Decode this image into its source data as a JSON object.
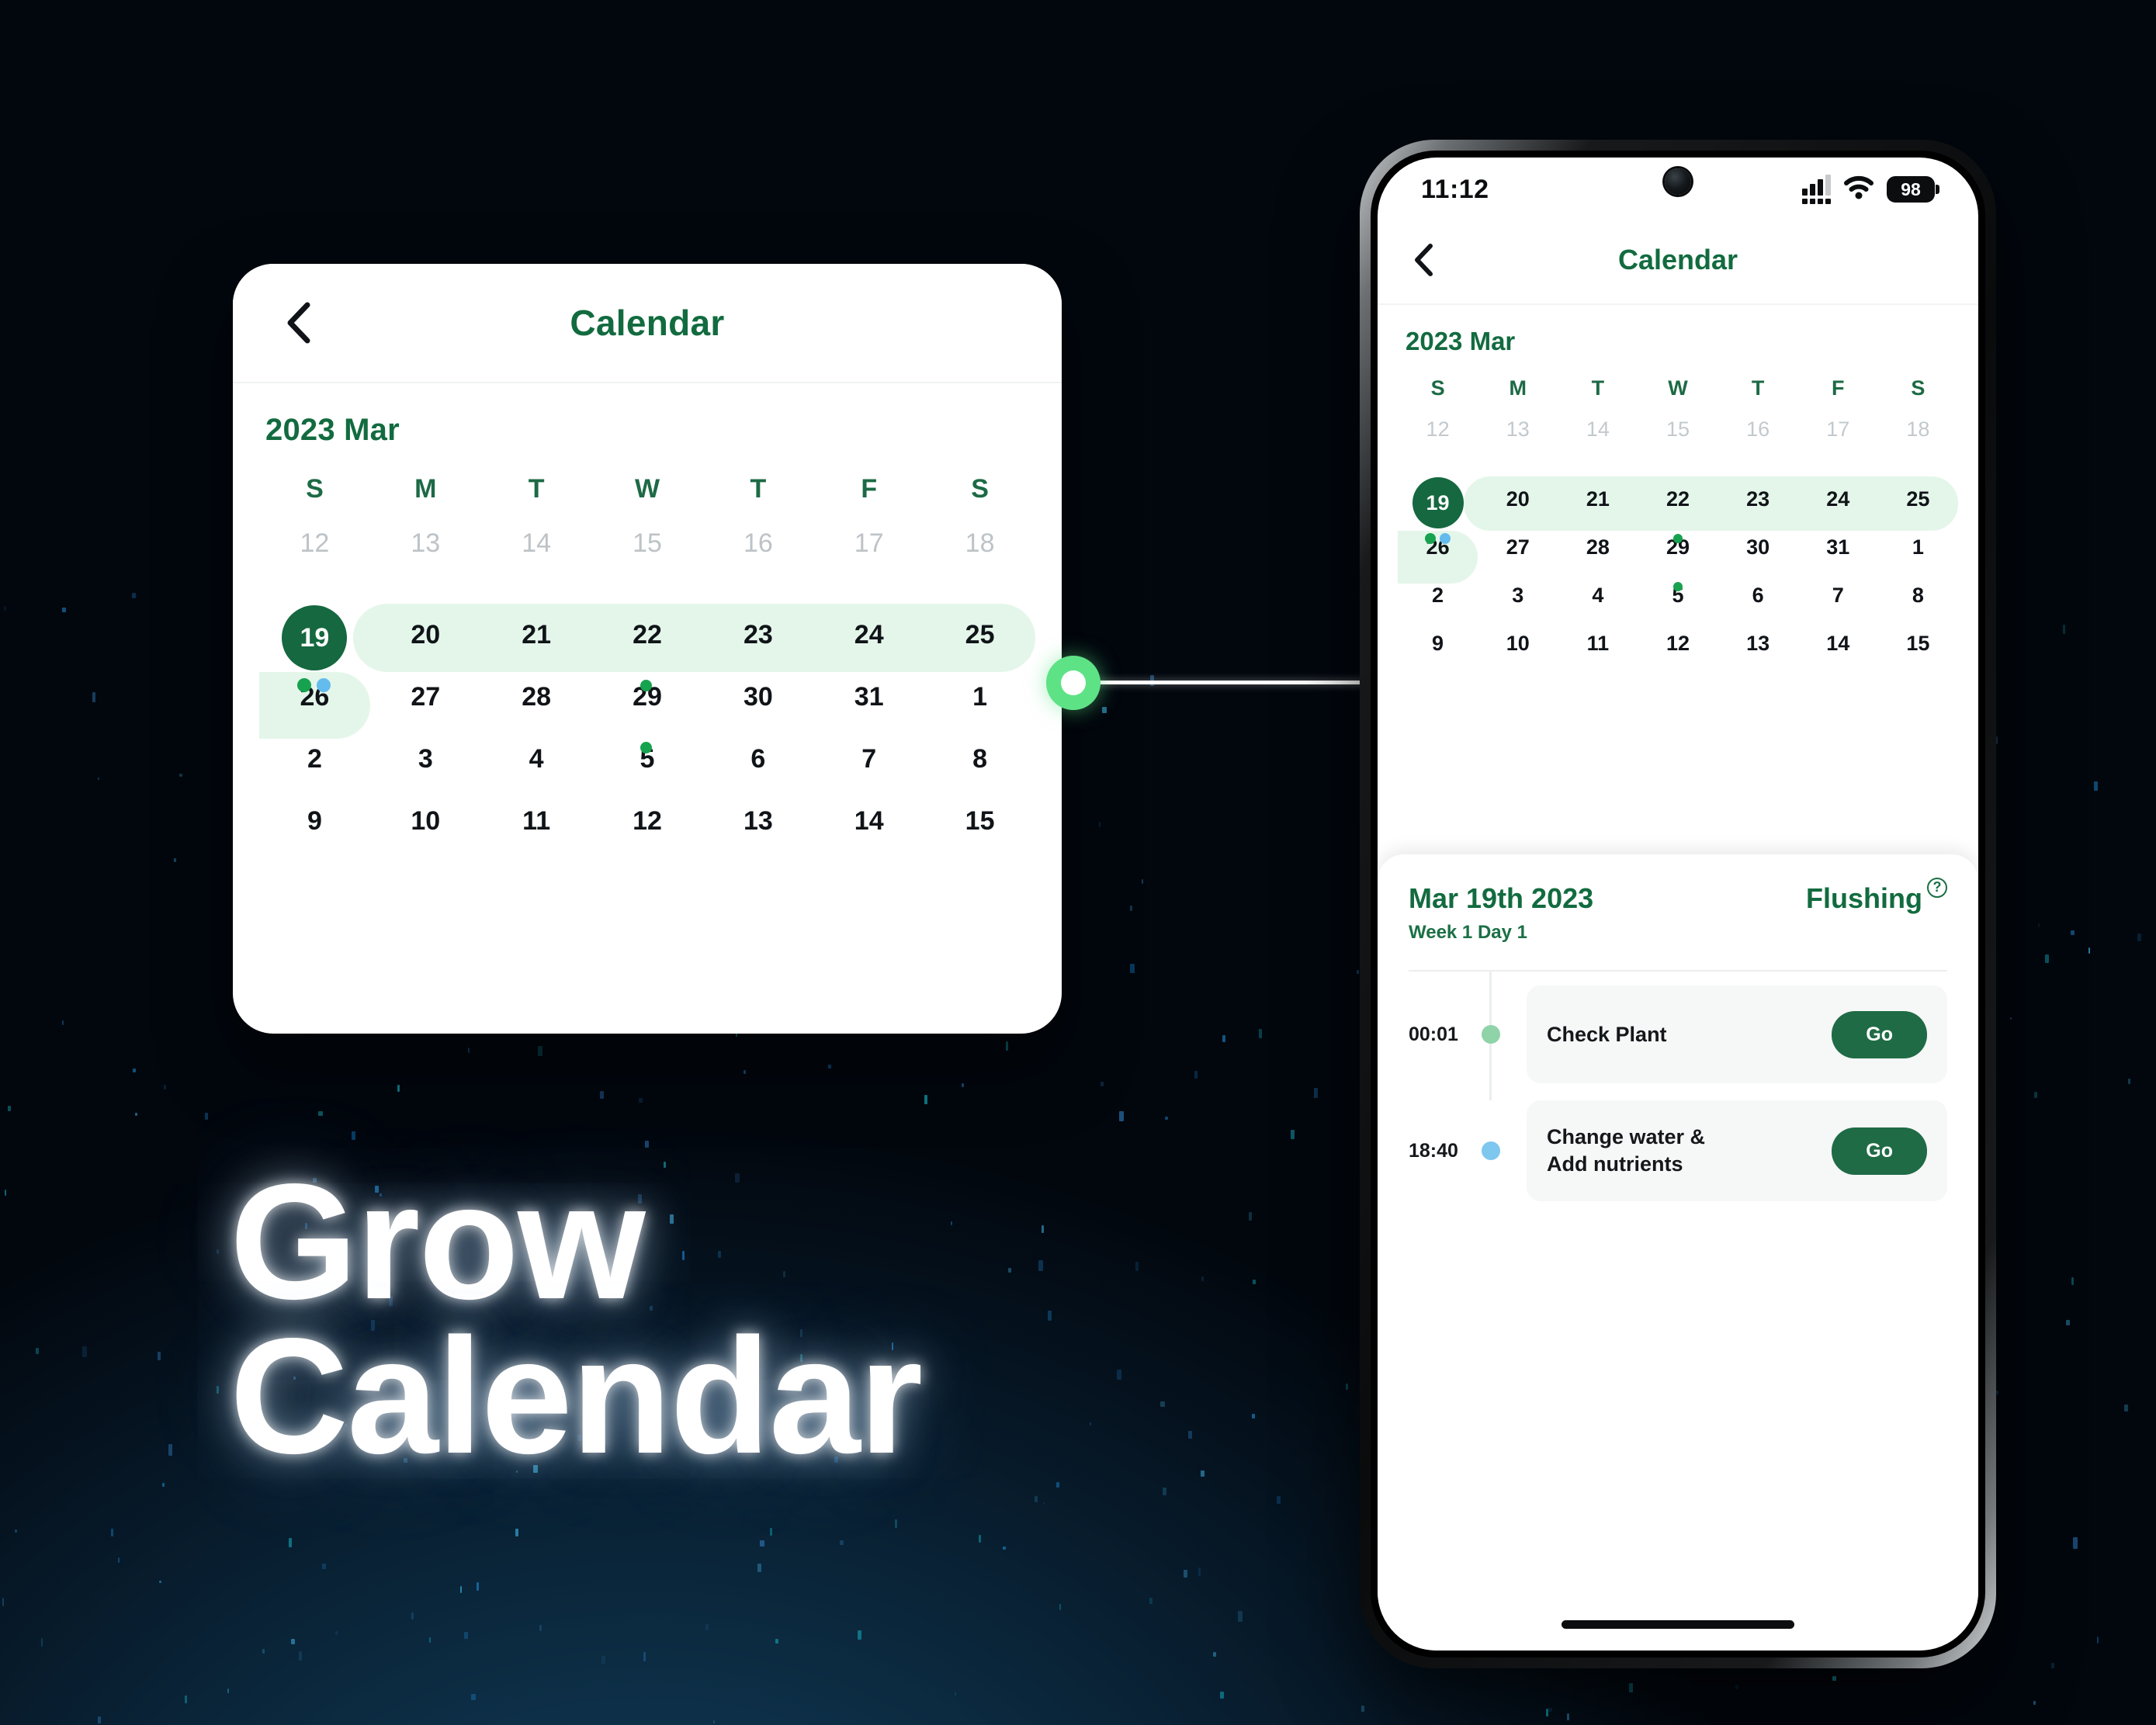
{
  "theme": {
    "brand_green": "#126b3f",
    "accent_green": "#1f6b45",
    "light_green_band": "#e4f6ea",
    "dot_green": "#17a24f",
    "dot_blue": "#63bced",
    "connector_green": "#5ee286",
    "background_navy": "#0d2f47"
  },
  "headline": {
    "line1": "Grow",
    "line2": "Calendar"
  },
  "card": {
    "back_icon": "chevron-left-icon",
    "title": "Calendar",
    "month": "2023 Mar",
    "dow": [
      "S",
      "M",
      "T",
      "W",
      "T",
      "F",
      "S"
    ],
    "weeks": [
      [
        "12",
        "13",
        "14",
        "15",
        "16",
        "17",
        "18"
      ],
      [
        "19",
        "20",
        "21",
        "22",
        "23",
        "24",
        "25"
      ],
      [
        "26",
        "27",
        "28",
        "29",
        "30",
        "31",
        "1"
      ],
      [
        "2",
        "3",
        "4",
        "5",
        "6",
        "7",
        "8"
      ],
      [
        "9",
        "10",
        "11",
        "12",
        "13",
        "14",
        "15"
      ]
    ],
    "selected_day": "19",
    "selected_day_dots": [
      "green",
      "blue"
    ],
    "event_dots": {
      "22": "green",
      "29": "green"
    },
    "muted_week_index": 0,
    "highlight_week_index": 1,
    "highlight_next_cell": "26"
  },
  "phone": {
    "status": {
      "time": "11:12",
      "signal_icon": "cellular-signal-icon",
      "wifi_icon": "wifi-icon",
      "battery_icon": "battery-icon",
      "battery_level": "98"
    },
    "nav": {
      "back_icon": "chevron-left-icon",
      "title": "Calendar"
    },
    "month": "2023 Mar",
    "dow": [
      "S",
      "M",
      "T",
      "W",
      "T",
      "F",
      "S"
    ],
    "weeks": [
      [
        "12",
        "13",
        "14",
        "15",
        "16",
        "17",
        "18"
      ],
      [
        "19",
        "20",
        "21",
        "22",
        "23",
        "24",
        "25"
      ],
      [
        "26",
        "27",
        "28",
        "29",
        "30",
        "31",
        "1"
      ],
      [
        "2",
        "3",
        "4",
        "5",
        "6",
        "7",
        "8"
      ],
      [
        "9",
        "10",
        "11",
        "12",
        "13",
        "14",
        "15"
      ]
    ],
    "selected_day": "19",
    "event_panel": {
      "date": "Mar 19th 2023",
      "subtitle": "Week 1 Day 1",
      "stage": "Flushing",
      "help_icon": "help-circle-icon",
      "help_glyph": "?",
      "events": [
        {
          "time": "00:01",
          "bullet": "green",
          "label": "Check Plant",
          "label_line2": "",
          "action": "Go"
        },
        {
          "time": "18:40",
          "bullet": "blue",
          "label": "Change water &",
          "label_line2": "Add nutrients",
          "action": "Go"
        }
      ]
    },
    "home_indicator": "home-indicator"
  }
}
